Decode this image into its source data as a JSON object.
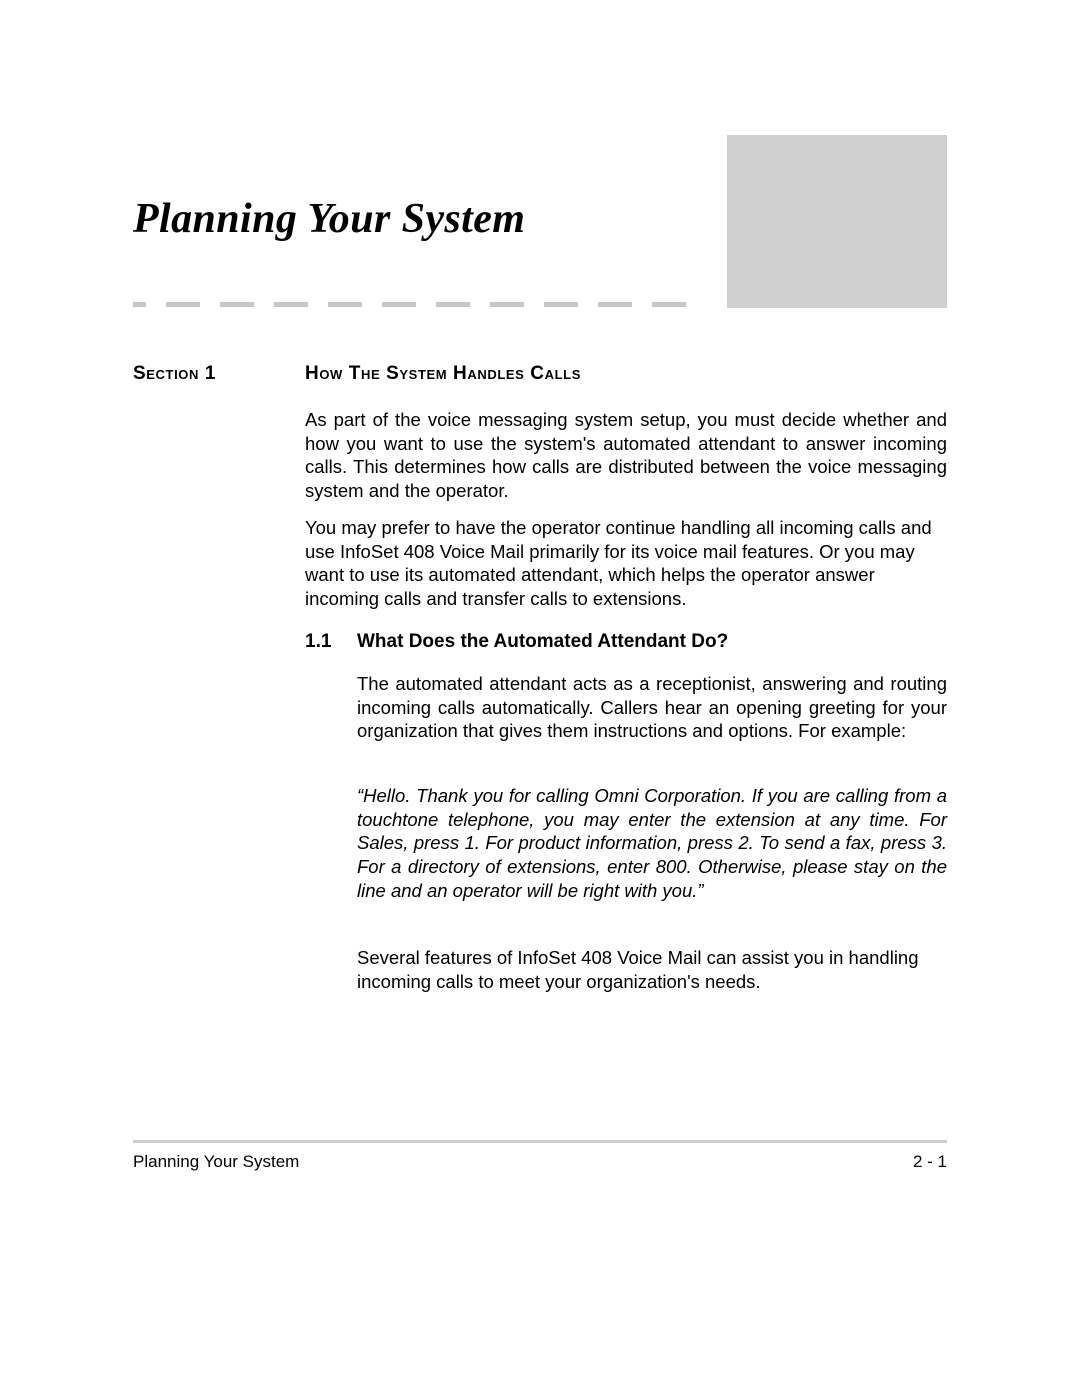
{
  "chapter": {
    "title": "Planning Your System"
  },
  "section": {
    "label": "Section  1",
    "title": "How The System Handles Calls",
    "paragraphs": {
      "intro1": "As part of the voice messaging system setup, you must decide whether and how you want to use the system's automated attendant to answer incoming calls. This determines how calls are distributed between the voice messaging system and the operator.",
      "intro2": "You may prefer to have the operator continue handling all incoming calls and use InfoSet 408 Voice Mail primarily for its voice mail features. Or you may want to use its automated attendant, which helps the operator answer incoming calls and transfer calls to extensions."
    }
  },
  "subsection": {
    "number": "1.1",
    "title": "What Does the Automated Attendant Do?",
    "paragraphs": {
      "p1": "The automated attendant acts as a receptionist, answering and routing incoming calls automatically. Callers hear an opening greeting for your organization that gives them instructions and options. For example:",
      "quote": "“Hello. Thank you for calling Omni Corporation. If you are calling from a touchtone telephone, you may enter the extension at any time. For Sales, press 1. For product information, press 2. To send a fax, press 3. For a directory of extensions, enter 800. Otherwise, please stay on the line and an operator will be right with you.”",
      "p3": "Several features of InfoSet 408 Voice Mail can assist you in handling incoming calls to meet your organization's needs."
    }
  },
  "footer": {
    "left": "Planning Your System",
    "right": "2 - 1"
  }
}
